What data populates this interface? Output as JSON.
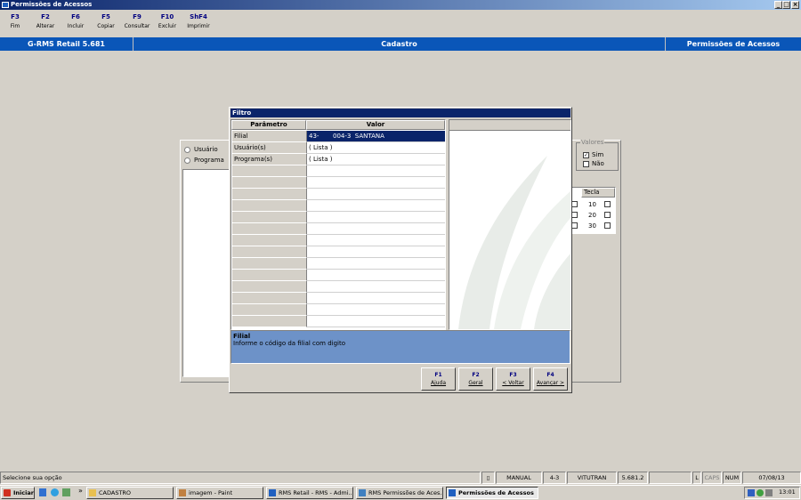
{
  "window": {
    "title": "Permissões de Acessos"
  },
  "toolbar": {
    "buttons": [
      {
        "key": "F3",
        "label": "Fim"
      },
      {
        "key": "F2",
        "label": "Alterar"
      },
      {
        "key": "F6",
        "label": "Incluir"
      },
      {
        "key": "F5",
        "label": "Copiar"
      },
      {
        "key": "F9",
        "label": "Consultar"
      },
      {
        "key": "F10",
        "label": "Excluir"
      },
      {
        "key": "ShF4",
        "label": "Imprimir"
      }
    ]
  },
  "header": {
    "app": "G-RMS Retail 5.681",
    "section": "Cadastro",
    "screen": "Permissões de Acessos"
  },
  "background": {
    "radios": [
      "Usuário",
      "Programa"
    ],
    "valores": {
      "title": "Valores",
      "sim": "Sim",
      "nao": "Não"
    },
    "tecla": {
      "header": "Tecla",
      "rows": [
        "10",
        "20",
        "30"
      ]
    }
  },
  "dialog": {
    "title": "Filtro",
    "columns": {
      "param": "Parâmetro",
      "value": "Valor"
    },
    "rows": [
      {
        "param": "Filial",
        "value": "43-       004-3  SANTANA"
      },
      {
        "param": "Usuário(s)",
        "value": "( Lista )"
      },
      {
        "param": "Programa(s)",
        "value": "( Lista )"
      }
    ],
    "help": {
      "title": "Filial",
      "text": "Informe o código da filial com digito"
    },
    "buttons": [
      {
        "key": "F1",
        "label": "Ajuda"
      },
      {
        "key": "F2",
        "label": "Geral"
      },
      {
        "key": "F3",
        "label": "< Voltar"
      },
      {
        "key": "F4",
        "label": "Avançar >"
      }
    ]
  },
  "statusbar": {
    "message": "Selecione sua opção",
    "mode": "MANUAL",
    "code": "4-3",
    "user": "VITUTRAN",
    "version": "5.681.2",
    "l": "L",
    "caps": "CAPS",
    "num": "NUM",
    "date": "07/08/13"
  },
  "taskbar": {
    "start": "Iniciar",
    "tasks": [
      "CADASTRO",
      "imagem - Paint",
      "RMS Retail - RMS - Admi...",
      "RMS Permissões de Aces...",
      "Permissões de Acessos"
    ],
    "time": "13:01"
  }
}
